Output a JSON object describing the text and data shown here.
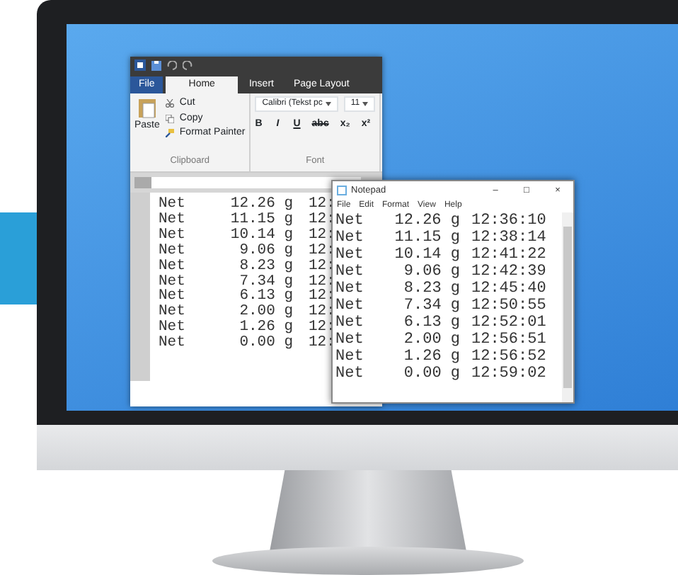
{
  "word": {
    "tabs": [
      {
        "label": "File",
        "selected": false
      },
      {
        "label": "Home",
        "selected": true
      },
      {
        "label": "Insert",
        "selected": false
      },
      {
        "label": "Page Layout",
        "selected": false
      }
    ],
    "clipboard": {
      "paste": "Paste",
      "items": [
        "Cut",
        "Copy",
        "Format Painter"
      ],
      "label": "Clipboard"
    },
    "font": {
      "name": "Calibri (Tekst pc",
      "size": "11",
      "format_buttons": [
        "B",
        "I",
        "U",
        "abc",
        "x₂",
        "x²"
      ],
      "label": "Font"
    },
    "rows": [
      [
        "Net",
        "12.26 g",
        "12:"
      ],
      [
        "Net",
        "11.15 g",
        "12:"
      ],
      [
        "Net",
        "10.14 g",
        "12:"
      ],
      [
        "Net",
        "9.06 g",
        "12:"
      ],
      [
        "Net",
        "8.23 g",
        "12:"
      ],
      [
        "Net",
        "7.34 g",
        "12:"
      ],
      [
        "Net",
        "6.13 g",
        "12:"
      ],
      [
        "Net",
        "2.00 g",
        "12:"
      ],
      [
        "Net",
        "1.26 g",
        "12:"
      ],
      [
        "Net",
        "0.00 g",
        "12:"
      ]
    ]
  },
  "notepad": {
    "title": "Notepad",
    "controls": [
      "–",
      "□",
      "×"
    ],
    "menu": [
      "File",
      "Edit",
      "Format",
      "View",
      "Help"
    ],
    "rows": [
      [
        "Net",
        "12.26 g",
        "12:36:10"
      ],
      [
        "Net",
        "11.15 g",
        "12:38:14"
      ],
      [
        "Net",
        "10.14 g",
        "12:41:22"
      ],
      [
        "Net",
        "9.06 g",
        "12:42:39"
      ],
      [
        "Net",
        "8.23 g",
        "12:45:40"
      ],
      [
        "Net",
        "7.34 g",
        "12:50:55"
      ],
      [
        "Net",
        "6.13 g",
        "12:52:01"
      ],
      [
        "Net",
        "2.00 g",
        "12:56:51"
      ],
      [
        "Net",
        "1.26 g",
        "12:56:52"
      ],
      [
        "Net",
        "0.00 g",
        "12:59:02"
      ]
    ]
  }
}
